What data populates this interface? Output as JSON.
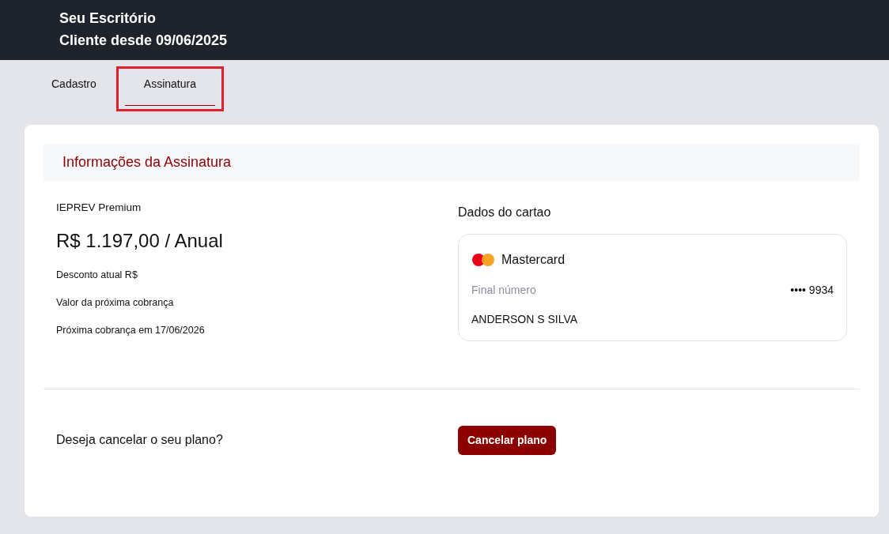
{
  "header": {
    "title": "Seu Escritório",
    "subtitle": "Cliente desde 09/06/2025"
  },
  "tabs": [
    {
      "label": "Cadastro",
      "selected": false,
      "highlighted": false
    },
    {
      "label": "Assinatura",
      "selected": true,
      "highlighted": true
    }
  ],
  "section_title": "Informações da Assinatura",
  "plan": {
    "name": "IEPREV Premium",
    "price": "R$ 1.197,00 / Anual",
    "details": [
      "Desconto atual R$",
      "Valor da próxima cobrança",
      "Próxima cobrança em 17/06/2026"
    ]
  },
  "card_section": {
    "title": "Dados do cartao",
    "brand": "Mastercard",
    "number_label": "Final número",
    "number_value": "•••• 9934",
    "holder": "ANDERSON S SILVA"
  },
  "cancel": {
    "question": "Deseja cancelar o seu plano?",
    "button": "Cancelar plano"
  }
}
